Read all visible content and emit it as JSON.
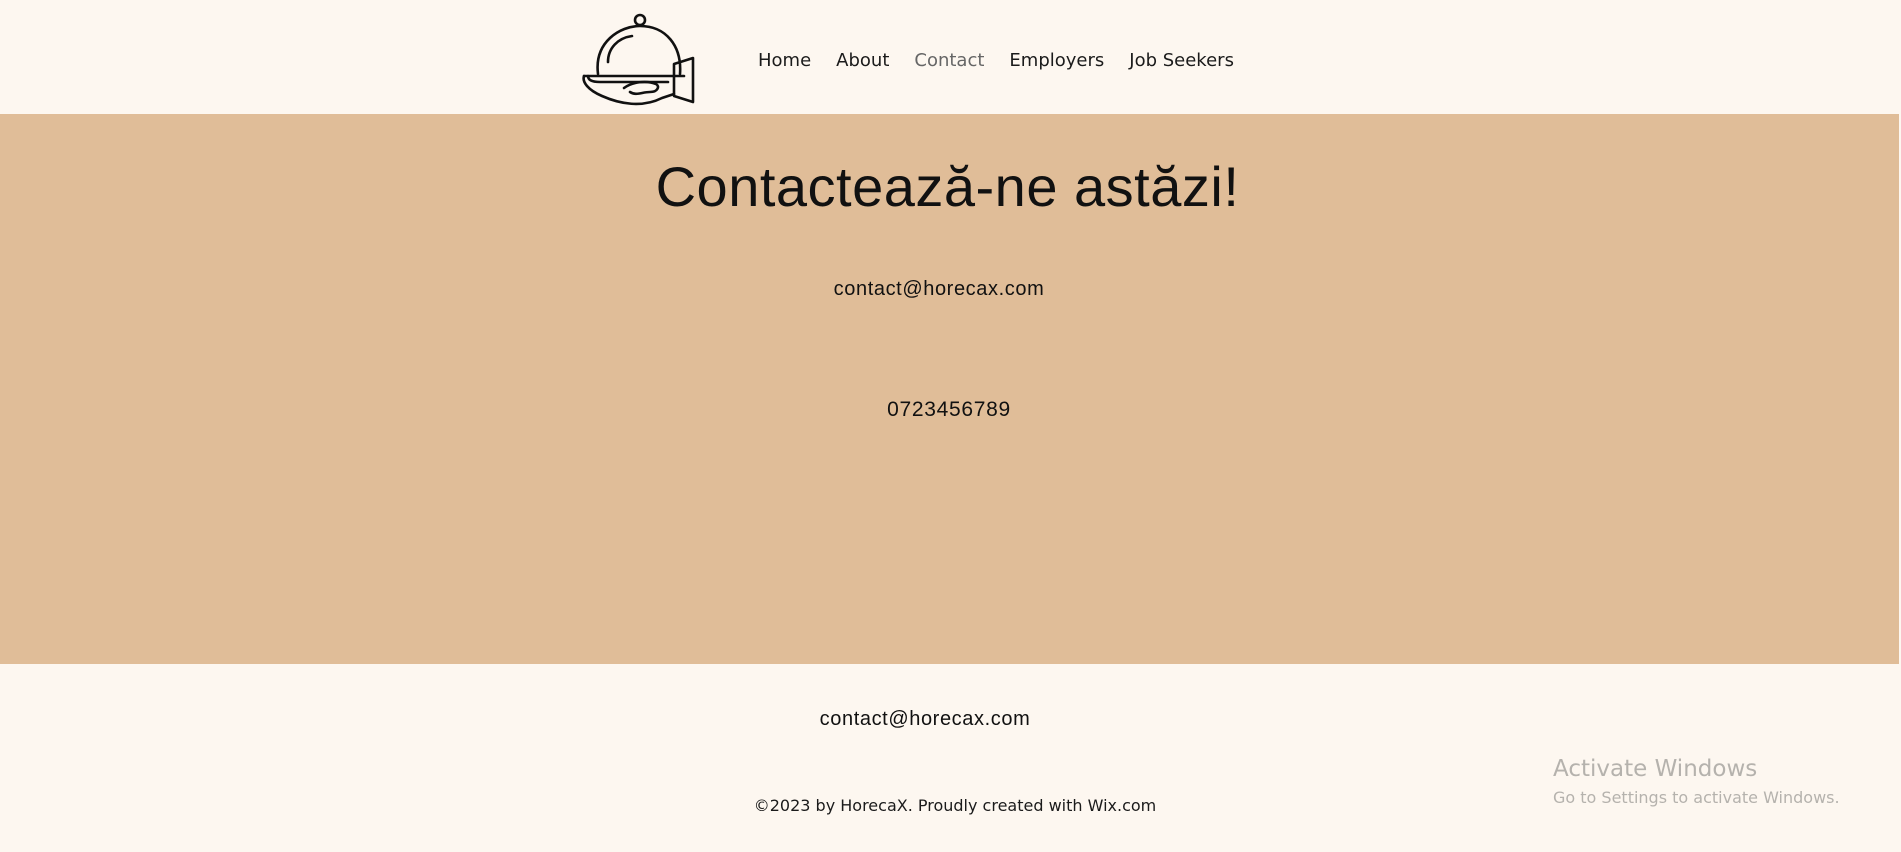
{
  "header": {
    "logo_icon": "serving-cloche-hand-icon",
    "nav": [
      {
        "label": "Home"
      },
      {
        "label": "About"
      },
      {
        "label": "Contact",
        "active": true
      },
      {
        "label": "Employers"
      },
      {
        "label": "Job Seekers"
      }
    ]
  },
  "hero": {
    "title": "Contactează-ne astăzi!",
    "email": "contact@horecax.com",
    "phone": "0723456789",
    "background": "#e0bd98"
  },
  "footer": {
    "email": "contact@horecax.com",
    "copyright": "©2023 by HorecaX. Proudly created with Wix.com"
  },
  "watermark": {
    "title": "Activate Windows",
    "subtitle": "Go to Settings to activate Windows."
  },
  "colors": {
    "page_bg": "#fdf7f0",
    "band_bg": "#e0bd98",
    "text": "#111111"
  }
}
